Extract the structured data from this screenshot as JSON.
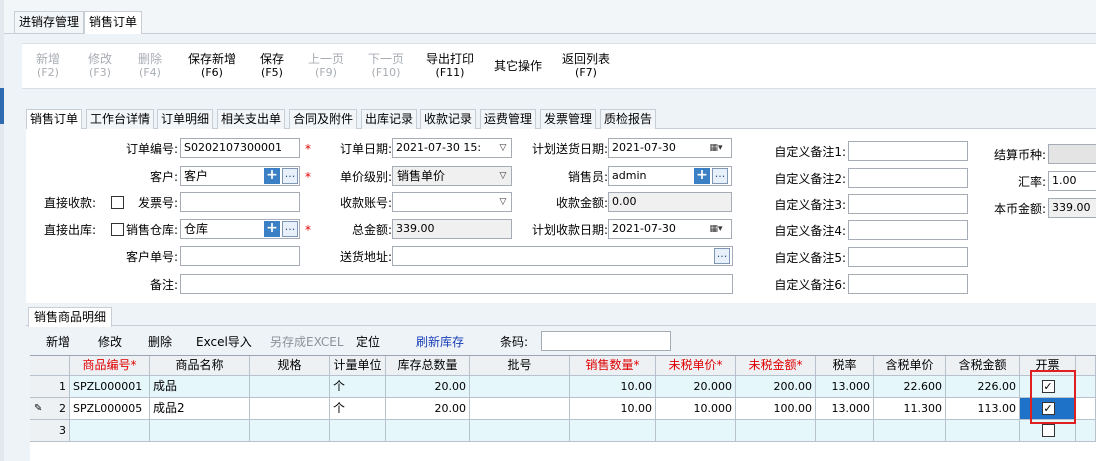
{
  "doc_tabs": [
    "进销存管理",
    "销售订单"
  ],
  "toolbar": [
    {
      "label": "新增",
      "key": "(F2)",
      "enabled": false
    },
    {
      "label": "修改",
      "key": "(F3)",
      "enabled": false
    },
    {
      "label": "删除",
      "key": "(F4)",
      "enabled": false
    },
    {
      "label": "保存新增",
      "key": "(F6)",
      "enabled": true
    },
    {
      "label": "保存",
      "key": "(F5)",
      "enabled": true
    },
    {
      "label": "上一页",
      "key": "(F9)",
      "enabled": false
    },
    {
      "label": "下一页",
      "key": "(F10)",
      "enabled": false
    },
    {
      "label": "导出打印",
      "key": "(F11)",
      "enabled": true
    },
    {
      "label": "其它操作",
      "key": "",
      "enabled": true
    },
    {
      "label": "返回列表",
      "key": "(F7)",
      "enabled": true
    }
  ],
  "form_tabs": [
    "销售订单",
    "工作台详情",
    "订单明细",
    "相关支出单",
    "合同及附件",
    "出库记录",
    "收款记录",
    "运费管理",
    "发票管理",
    "质检报告"
  ],
  "form": {
    "order_no": {
      "label": "订单编号:",
      "value": "S0202107300001"
    },
    "customer": {
      "label": "客户:",
      "value": "客户"
    },
    "direct_receipt": {
      "label": "直接收款:"
    },
    "invoice_no": {
      "label": "发票号:",
      "value": ""
    },
    "direct_outbound": {
      "label": "直接出库:"
    },
    "warehouse": {
      "label": "销售仓库:",
      "value": "仓库"
    },
    "customer_doc": {
      "label": "客户单号:",
      "value": ""
    },
    "remark": {
      "label": "备注:",
      "value": ""
    },
    "order_date": {
      "label": "订单日期:",
      "value": "2021-07-30 15:"
    },
    "price_level": {
      "label": "单价级别:",
      "value": "销售单价"
    },
    "account": {
      "label": "收款账号:",
      "value": ""
    },
    "total": {
      "label": "总金额:",
      "value": "339.00"
    },
    "address": {
      "label": "送货地址:",
      "value": ""
    },
    "plan_ship_date": {
      "label": "计划送货日期:",
      "value": "2021-07-30"
    },
    "salesman": {
      "label": "销售员:",
      "value": "admin"
    },
    "received": {
      "label": "收款金额:",
      "value": "0.00"
    },
    "plan_receipt_date": {
      "label": "计划收款日期:",
      "value": "2021-07-30"
    },
    "custom_remarks": [
      "自定义备注1:",
      "自定义备注2:",
      "自定义备注3:",
      "自定义备注4:",
      "自定义备注5:",
      "自定义备注6:"
    ],
    "currency": {
      "label": "结算币种:",
      "value": ""
    },
    "rate": {
      "label": "汇率:",
      "value": "1.00"
    },
    "local_amount": {
      "label": "本币金额:",
      "value": "339.00"
    }
  },
  "section_title": "销售商品明细",
  "grid_toolbar": [
    {
      "label": "新增",
      "style": "normal"
    },
    {
      "label": "修改",
      "style": "normal"
    },
    {
      "label": "删除",
      "style": "normal"
    },
    {
      "label": "Excel导入",
      "style": "normal"
    },
    {
      "label": "另存成EXCEL",
      "style": "disabled"
    },
    {
      "label": "定位",
      "style": "normal"
    },
    {
      "label": "刷新库存",
      "style": "blue"
    }
  ],
  "barcode_label": "条码:",
  "columns": [
    {
      "label": "商品编号*",
      "required": true
    },
    {
      "label": "商品名称",
      "required": false
    },
    {
      "label": "规格",
      "required": false
    },
    {
      "label": "计量单位",
      "required": false
    },
    {
      "label": "库存总数量",
      "required": false
    },
    {
      "label": "批号",
      "required": false
    },
    {
      "label": "销售数量*",
      "required": true
    },
    {
      "label": "未税单价*",
      "required": true
    },
    {
      "label": "未税金额*",
      "required": true
    },
    {
      "label": "税率",
      "required": false
    },
    {
      "label": "含税单价",
      "required": false
    },
    {
      "label": "含税金额",
      "required": false
    },
    {
      "label": "开票",
      "required": false
    }
  ],
  "rows": [
    {
      "no": "1",
      "cells": [
        "SPZL000001",
        "成品",
        "",
        "个",
        "20.00",
        "",
        "10.00",
        "20.000",
        "200.00",
        "13.000",
        "22.600",
        "226.00"
      ],
      "invoice": true
    },
    {
      "no": "2",
      "cells": [
        "SPZL000005",
        "成品2",
        "",
        "个",
        "20.00",
        "",
        "10.00",
        "10.000",
        "100.00",
        "13.000",
        "11.300",
        "113.00"
      ],
      "invoice": true
    },
    {
      "no": "3",
      "cells": [
        "",
        "",
        "",
        "",
        "",
        "",
        "",
        "",
        "",
        "",
        "",
        ""
      ],
      "invoice": false
    }
  ],
  "colors": {
    "required": "#e00000",
    "selected_cell": "#1e73c9",
    "highlight_box": "#e02020"
  }
}
